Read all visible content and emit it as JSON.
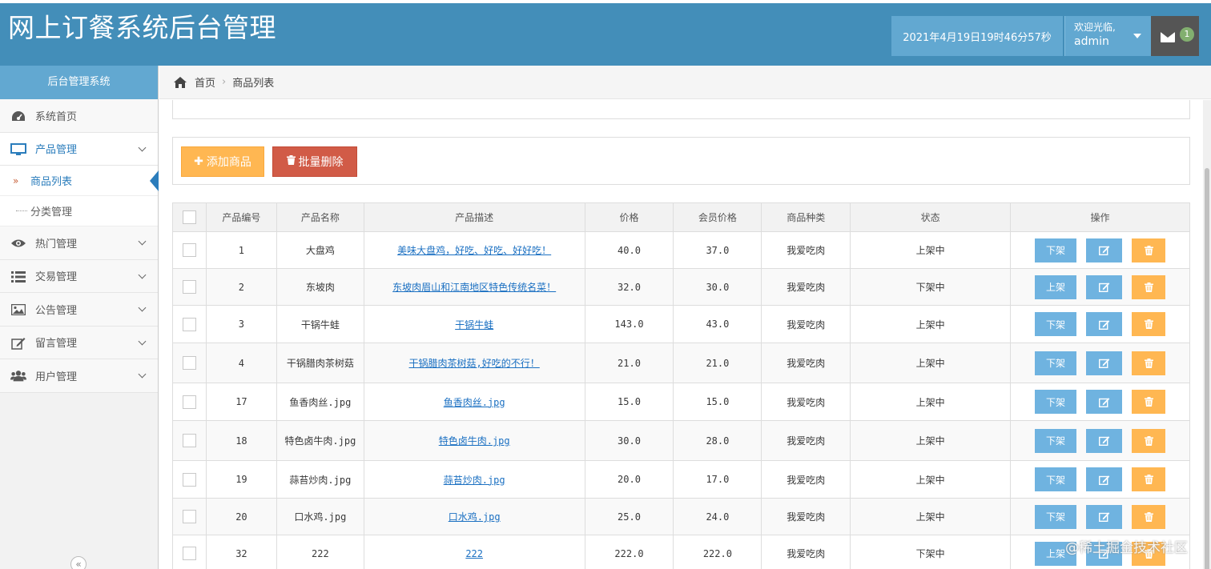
{
  "header": {
    "title": "网上订餐系统后台管理",
    "datetime": "2021年4月19日19时46分57秒",
    "welcome": "欢迎光临,",
    "username": "admin",
    "mail_badge": "1"
  },
  "sidebar": {
    "title": "后台管理系统",
    "items": [
      {
        "label": "系统首页",
        "icon": "dashboard-icon"
      },
      {
        "label": "产品管理",
        "icon": "desktop-icon"
      },
      {
        "label": "热门管理",
        "icon": "eye-icon"
      },
      {
        "label": "交易管理",
        "icon": "list-icon"
      },
      {
        "label": "公告管理",
        "icon": "picture-icon"
      },
      {
        "label": "留言管理",
        "icon": "edit-icon"
      },
      {
        "label": "用户管理",
        "icon": "users-icon"
      }
    ],
    "subitems": [
      {
        "label": "商品列表",
        "active": true
      },
      {
        "label": "分类管理",
        "active": false
      }
    ]
  },
  "breadcrumb": {
    "home": "首页",
    "current": "商品列表"
  },
  "toolbar": {
    "add_label": "添加商品",
    "batch_delete_label": "批量删除"
  },
  "table": {
    "headers": [
      "产品编号",
      "产品名称",
      "产品描述",
      "价格",
      "会员价格",
      "商品种类",
      "状态",
      "操作"
    ],
    "rows": [
      {
        "id": "1",
        "name": "大盘鸡",
        "desc": "美味大盘鸡，好吃、好吃、好好吃！",
        "price": "40.0",
        "member_price": "37.0",
        "category": "我爱吃肉",
        "status": "上架中",
        "action": "下架"
      },
      {
        "id": "2",
        "name": "东坡肉",
        "desc": "东坡肉眉山和江南地区特色传统名菜！",
        "price": "32.0",
        "member_price": "30.0",
        "category": "我爱吃肉",
        "status": "下架中",
        "action": "上架"
      },
      {
        "id": "3",
        "name": "干锅牛蛙",
        "desc": "干锅牛蛙",
        "price": "143.0",
        "member_price": "43.0",
        "category": "我爱吃肉",
        "status": "上架中",
        "action": "下架"
      },
      {
        "id": "4",
        "name": "干锅腊肉茶树菇",
        "desc": "干锅腊肉茶树菇,好吃的不行！",
        "price": "21.0",
        "member_price": "21.0",
        "category": "我爱吃肉",
        "status": "上架中",
        "action": "下架"
      },
      {
        "id": "17",
        "name": "鱼香肉丝.jpg",
        "desc": "鱼香肉丝.jpg",
        "price": "15.0",
        "member_price": "15.0",
        "category": "我爱吃肉",
        "status": "上架中",
        "action": "下架"
      },
      {
        "id": "18",
        "name": "特色卤牛肉.jpg",
        "desc": "特色卤牛肉.jpg",
        "price": "30.0",
        "member_price": "28.0",
        "category": "我爱吃肉",
        "status": "上架中",
        "action": "下架"
      },
      {
        "id": "19",
        "name": "蒜苔炒肉.jpg",
        "desc": "蒜苔炒肉.jpg",
        "price": "20.0",
        "member_price": "17.0",
        "category": "我爱吃肉",
        "status": "上架中",
        "action": "下架"
      },
      {
        "id": "20",
        "name": "口水鸡.jpg",
        "desc": "口水鸡.jpg",
        "price": "25.0",
        "member_price": "24.0",
        "category": "我爱吃肉",
        "status": "上架中",
        "action": "下架"
      },
      {
        "id": "32",
        "name": "222",
        "desc": "222",
        "price": "222.0",
        "member_price": "222.0",
        "category": "我爱吃肉",
        "status": "下架中",
        "action": "上架"
      }
    ]
  },
  "watermark": "@稀土掘金技术社区"
}
